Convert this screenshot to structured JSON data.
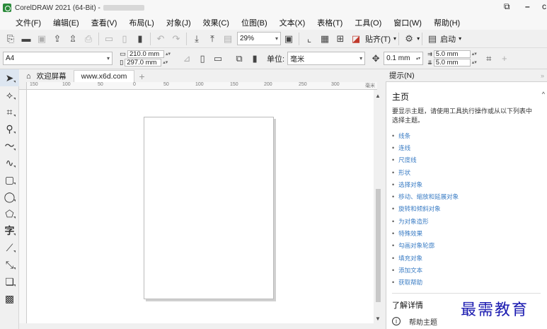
{
  "titlebar": {
    "title": "CorelDRAW 2021 (64-Bit) -",
    "restore_icon": "restore-icon",
    "minimize": "–",
    "close_partial": "c"
  },
  "menu": [
    "文件(F)",
    "编辑(E)",
    "查看(V)",
    "布局(L)",
    "对象(J)",
    "效果(C)",
    "位图(B)",
    "文本(X)",
    "表格(T)",
    "工具(O)",
    "窗口(W)",
    "帮助(H)"
  ],
  "toolbar": {
    "zoom": "29%",
    "snap_label": "贴齐(T)",
    "launch_label": "启动"
  },
  "propbar": {
    "page_size": "A4",
    "width": "210.0 mm",
    "height": "297.0 mm",
    "unit_label": "单位:",
    "unit_value": "毫米",
    "nudge": "0.1 mm",
    "dup_x": "5.0 mm",
    "dup_y": "5.0 mm"
  },
  "doctabs": {
    "welcome": "欢迎屏幕",
    "document": "www.x6d.com",
    "add": "+"
  },
  "ruler": {
    "ticks": [
      "150",
      "100",
      "50",
      "0",
      "50",
      "100",
      "150",
      "200",
      "250",
      "300"
    ],
    "unit": "毫米"
  },
  "docker": {
    "tab": "提示(N)",
    "title": "主页",
    "description": "要显示主题，请使用工具执行操作或从以下列表中选择主题。",
    "topics": [
      "线条",
      "连线",
      "尺度线",
      "形状",
      "选择对象",
      "移动、缩放和延展对象",
      "旋转和倾斜对象",
      "为对象造形",
      "特殊效果",
      "勾画对象轮廓",
      "填充对象",
      "添加文本",
      "获取帮助"
    ],
    "learn_more": "了解详情",
    "help_topics": "帮助主题"
  },
  "watermark": "最需教育"
}
